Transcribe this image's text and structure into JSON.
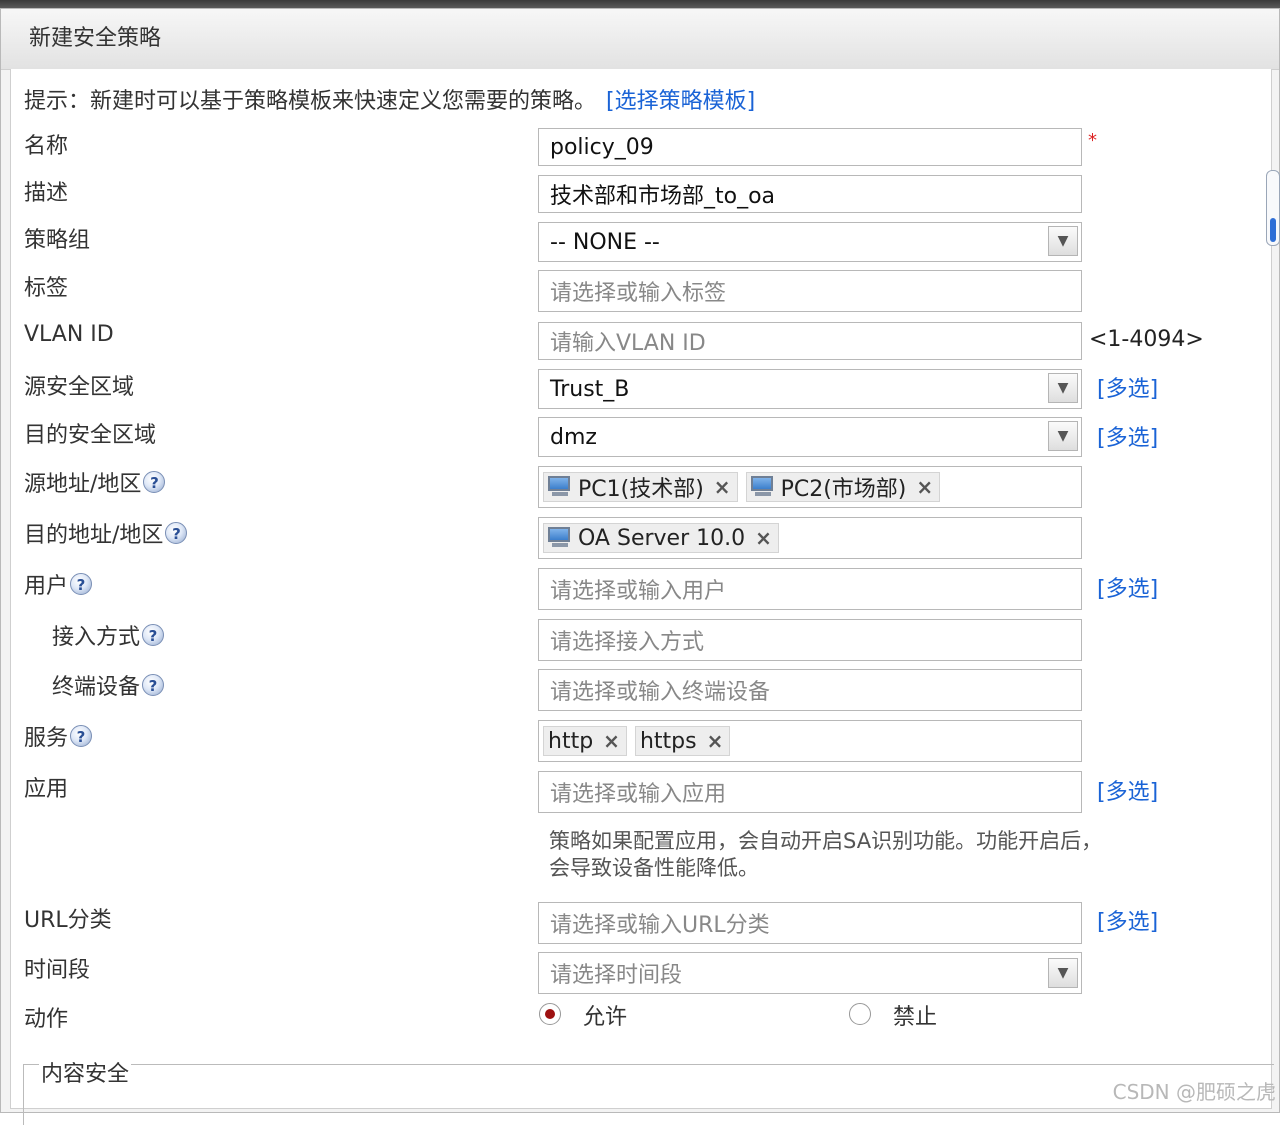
{
  "dialog": {
    "title": "新建安全策略"
  },
  "hint": {
    "text": "提示：新建时可以基于策略模板来快速定义您需要的策略。",
    "link": "[选择策略模板]"
  },
  "form": {
    "name": {
      "label": "名称",
      "value": "policy_09",
      "required_mark": "*"
    },
    "description": {
      "label": "描述",
      "value": "技术部和市场部_to_oa"
    },
    "policy_group": {
      "label": "策略组",
      "value": "-- NONE --"
    },
    "tag": {
      "label": "标签",
      "placeholder": "请选择或输入标签"
    },
    "vlan": {
      "label": "VLAN ID",
      "placeholder": "请输入VLAN ID",
      "range": "<1-4094>"
    },
    "src_zone": {
      "label": "源安全区域",
      "value": "Trust_B",
      "multi": "[多选]"
    },
    "dst_zone": {
      "label": "目的安全区域",
      "value": "dmz",
      "multi": "[多选]"
    },
    "src_addr": {
      "label": "源地址/地区",
      "tags": [
        "PC1(技术部)",
        "PC2(市场部)"
      ]
    },
    "dst_addr": {
      "label": "目的地址/地区",
      "tags": [
        "OA Server 10.0"
      ]
    },
    "user": {
      "label": "用户",
      "placeholder": "请选择或输入用户",
      "multi": "[多选]"
    },
    "access": {
      "label": "接入方式",
      "placeholder": "请选择接入方式"
    },
    "terminal": {
      "label": "终端设备",
      "placeholder": "请选择或输入终端设备"
    },
    "service": {
      "label": "服务",
      "tags": [
        "http",
        "https"
      ]
    },
    "application": {
      "label": "应用",
      "placeholder": "请选择或输入应用",
      "multi": "[多选]",
      "note": "策略如果配置应用，会自动开启SA识别功能。功能开启后，会导致设备性能降低。"
    },
    "url": {
      "label": "URL分类",
      "placeholder": "请选择或输入URL分类",
      "multi": "[多选]"
    },
    "time": {
      "label": "时间段",
      "placeholder": "请选择时间段"
    },
    "action": {
      "label": "动作",
      "options": [
        "允许",
        "禁止"
      ],
      "selected": "允许"
    }
  },
  "content_security": {
    "legend": "内容安全"
  },
  "watermark": "CSDN @肥硕之虎",
  "icons": {
    "help": "?",
    "remove": "×",
    "dropdown": "chevron-down-icon",
    "host": "computer-icon"
  },
  "colors": {
    "link": "#1a63d6",
    "radio_selected": "#9e1111",
    "required": "#dd2222"
  }
}
